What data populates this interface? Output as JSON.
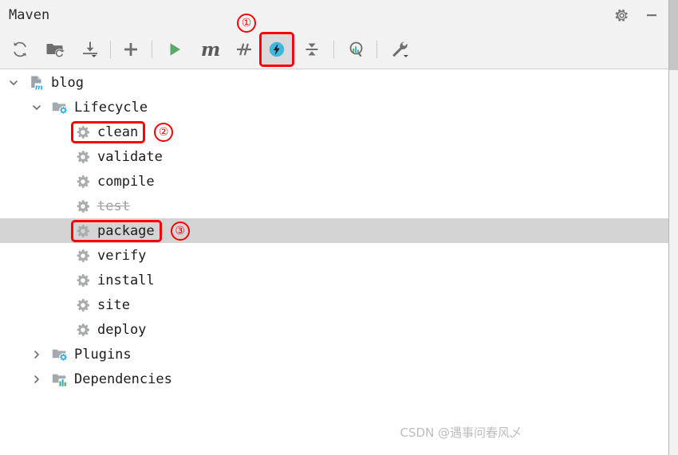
{
  "window": {
    "title": "Maven",
    "settings_label": "Settings",
    "minimize_label": "Minimize"
  },
  "toolbar": {
    "items": [
      {
        "name": "reload-all-maven-projects",
        "icon": "refresh-icon",
        "tooltip": "Reload All Maven Projects",
        "active": false,
        "annotated": false
      },
      {
        "name": "generate-sources-update-folders",
        "icon": "folder-refresh-icon",
        "tooltip": "Generate Sources and Update Folders For All Projects",
        "active": false,
        "annotated": false
      },
      {
        "name": "download-sources-documentation",
        "icon": "download-icon",
        "tooltip": "Download Sources and/or Documentation",
        "active": false,
        "annotated": false
      },
      {
        "name": "add-maven-project",
        "icon": "plus-icon",
        "tooltip": "Add Maven Projects",
        "active": false,
        "annotated": false
      },
      {
        "name": "execute-maven-goal",
        "icon": "run-triangle-icon",
        "tooltip": "Execute Maven Goal",
        "active": false,
        "annotated": false
      },
      {
        "name": "maven-settings",
        "icon": "maven-m-icon",
        "tooltip": "Maven Settings",
        "active": false,
        "annotated": false
      },
      {
        "name": "toggle-skip-tests",
        "icon": "skip-tests-icon",
        "tooltip": "Toggle 'Skip Tests' Mode",
        "active": false,
        "annotated": false
      },
      {
        "name": "toggle-offline-mode",
        "icon": "lightning-bolt-icon",
        "tooltip": "Toggle Offline Mode",
        "active": true,
        "annotated": true
      },
      {
        "name": "collapse-all",
        "icon": "collapse-all-icon",
        "tooltip": "Collapse All",
        "active": false,
        "annotated": false
      },
      {
        "name": "show-dependency-analyzer",
        "icon": "dependency-analyzer-icon",
        "tooltip": "Analyze Dependencies",
        "active": false,
        "annotated": false
      },
      {
        "name": "maven-build-tools",
        "icon": "wrench-icon",
        "tooltip": "Build Tool Settings",
        "active": false,
        "annotated": false
      }
    ]
  },
  "tree": {
    "rows": [
      {
        "label": "blog",
        "icon": "maven-project-icon",
        "twisty": "expanded",
        "indent": 0,
        "selected": false,
        "disabled": false,
        "boxed": false,
        "badge": null
      },
      {
        "label": "Lifecycle",
        "icon": "folder-gear-icon",
        "twisty": "expanded",
        "indent": 1,
        "selected": false,
        "disabled": false,
        "boxed": false,
        "badge": null
      },
      {
        "label": "clean",
        "icon": "gear-icon",
        "twisty": "none",
        "indent": 2,
        "selected": false,
        "disabled": false,
        "boxed": true,
        "badge": "②"
      },
      {
        "label": "validate",
        "icon": "gear-icon",
        "twisty": "none",
        "indent": 2,
        "selected": false,
        "disabled": false,
        "boxed": false,
        "badge": null
      },
      {
        "label": "compile",
        "icon": "gear-icon",
        "twisty": "none",
        "indent": 2,
        "selected": false,
        "disabled": false,
        "boxed": false,
        "badge": null
      },
      {
        "label": "test",
        "icon": "gear-icon",
        "twisty": "none",
        "indent": 2,
        "selected": false,
        "disabled": true,
        "boxed": false,
        "badge": null
      },
      {
        "label": "package",
        "icon": "gear-icon",
        "twisty": "none",
        "indent": 2,
        "selected": true,
        "disabled": false,
        "boxed": true,
        "badge": "③"
      },
      {
        "label": "verify",
        "icon": "gear-icon",
        "twisty": "none",
        "indent": 2,
        "selected": false,
        "disabled": false,
        "boxed": false,
        "badge": null
      },
      {
        "label": "install",
        "icon": "gear-icon",
        "twisty": "none",
        "indent": 2,
        "selected": false,
        "disabled": false,
        "boxed": false,
        "badge": null
      },
      {
        "label": "site",
        "icon": "gear-icon",
        "twisty": "none",
        "indent": 2,
        "selected": false,
        "disabled": false,
        "boxed": false,
        "badge": null
      },
      {
        "label": "deploy",
        "icon": "gear-icon",
        "twisty": "none",
        "indent": 2,
        "selected": false,
        "disabled": false,
        "boxed": false,
        "badge": null
      },
      {
        "label": "Plugins",
        "icon": "folder-gear-icon",
        "twisty": "collapsed",
        "indent": 1,
        "selected": false,
        "disabled": false,
        "boxed": false,
        "badge": null
      },
      {
        "label": "Dependencies",
        "icon": "folder-chart-icon",
        "twisty": "collapsed",
        "indent": 1,
        "selected": false,
        "disabled": false,
        "boxed": false,
        "badge": null
      }
    ]
  },
  "annotations": {
    "toolbar_badge": "①"
  },
  "watermark": {
    "text": "CSDN @遇事问春风乄"
  },
  "colors": {
    "annotation_red": "#fb0007",
    "selection_gray": "#d4d4d4",
    "toolbar_bg": "#f2f2f2",
    "icon_gray": "#6e6e6e",
    "run_green": "#59a869",
    "offline_blue": "#40b6e0"
  }
}
